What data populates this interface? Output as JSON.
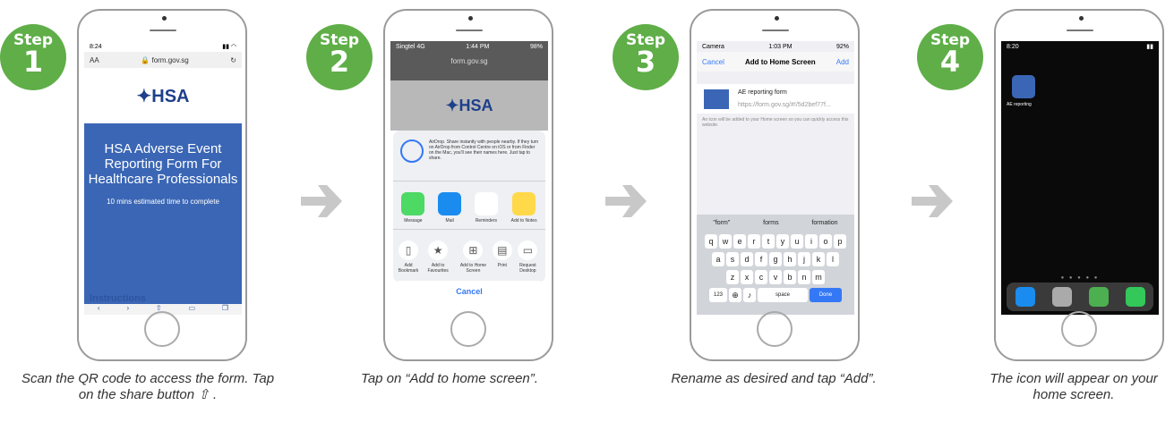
{
  "steps": [
    {
      "word": "Step",
      "num": "1",
      "caption": "Scan the QR code to access the form. Tap on the share button ⇧ .",
      "screen": {
        "time": "8:24",
        "address": "form.gov.sg",
        "hero_title": "HSA Adverse Event Reporting Form For Healthcare Professionals",
        "hero_meta": "10 mins estimated time to complete",
        "instructions": "Instructions",
        "logo": "HSA"
      }
    },
    {
      "word": "Step",
      "num": "2",
      "caption": "Tap on “Add to home screen”.",
      "screen": {
        "carrier": "Singtel 4G",
        "time": "1:44 PM",
        "address": "form.gov.sg",
        "airdrop": "AirDrop. Share instantly with people nearby. If they turn on AirDrop from Control Centre on iOS or from Finder on the Mac, you'll see their names here. Just tap to share.",
        "apps": [
          "Message",
          "Mail",
          "Reminders",
          "Add to Notes"
        ],
        "actions": [
          "Add Bookmark",
          "Add to Favourites",
          "Add to Home Screen",
          "Print",
          "Request Desktop"
        ],
        "cancel": "Cancel",
        "logo": "HSA"
      }
    },
    {
      "word": "Step",
      "num": "3",
      "caption": "Rename as desired and tap “Add”.",
      "screen": {
        "time": "1:03 PM",
        "cancel": "Cancel",
        "title": "Add to Home Screen",
        "add": "Add",
        "name": "AE reporting form",
        "url": "https://form.gov.sg/#!/5d2bef77f...",
        "note": "An icon will be added to your Home screen so you can quickly access this website.",
        "suggestions": [
          "\"form\"",
          "forms",
          "formation"
        ],
        "row1": [
          "q",
          "w",
          "e",
          "r",
          "t",
          "y",
          "u",
          "i",
          "o",
          "p"
        ],
        "row2": [
          "a",
          "s",
          "d",
          "f",
          "g",
          "h",
          "j",
          "k",
          "l"
        ],
        "row3": [
          "z",
          "x",
          "c",
          "v",
          "b",
          "n",
          "m"
        ],
        "k123": "123",
        "space": "space",
        "done": "Done"
      }
    },
    {
      "word": "Step",
      "num": "4",
      "caption": "The icon will appear on your home screen.",
      "screen": {
        "time": "8:20",
        "icon_label": "AE reporting"
      }
    }
  ],
  "colors": {
    "badge": "#5fae48",
    "arrow": "#c8c8c8",
    "hsa_blue": "#3a66b5"
  }
}
